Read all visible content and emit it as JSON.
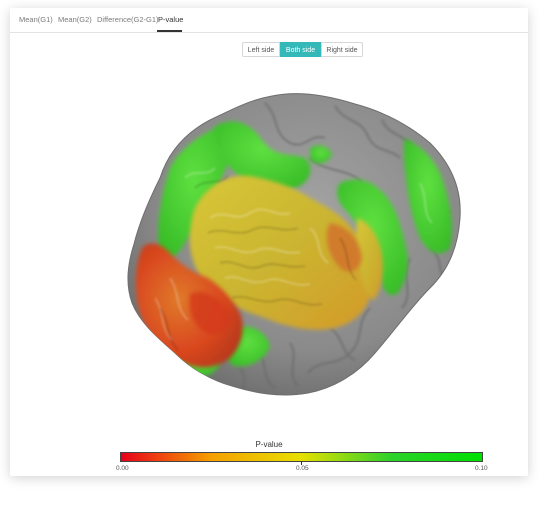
{
  "tabs": [
    {
      "label": "Mean(G1)"
    },
    {
      "label": "Mean(G2)"
    },
    {
      "label": "Difference(G2-G1)"
    },
    {
      "label": "P-value"
    }
  ],
  "active_tab": "P-value",
  "side_toggle": {
    "left": "Left side",
    "both": "Both side",
    "right": "Right side",
    "selected": "Both side"
  },
  "legend": {
    "title": "P-value",
    "min_label": "0.00",
    "mid_label": "0.05",
    "max_label": "0.10",
    "colors": [
      "#e8001a",
      "#f5a000",
      "#e6e000",
      "#2bd12b",
      "#00e000"
    ]
  },
  "colors": {
    "accent": "#35b8b8",
    "cortex_gray": "#8f8f8f"
  }
}
